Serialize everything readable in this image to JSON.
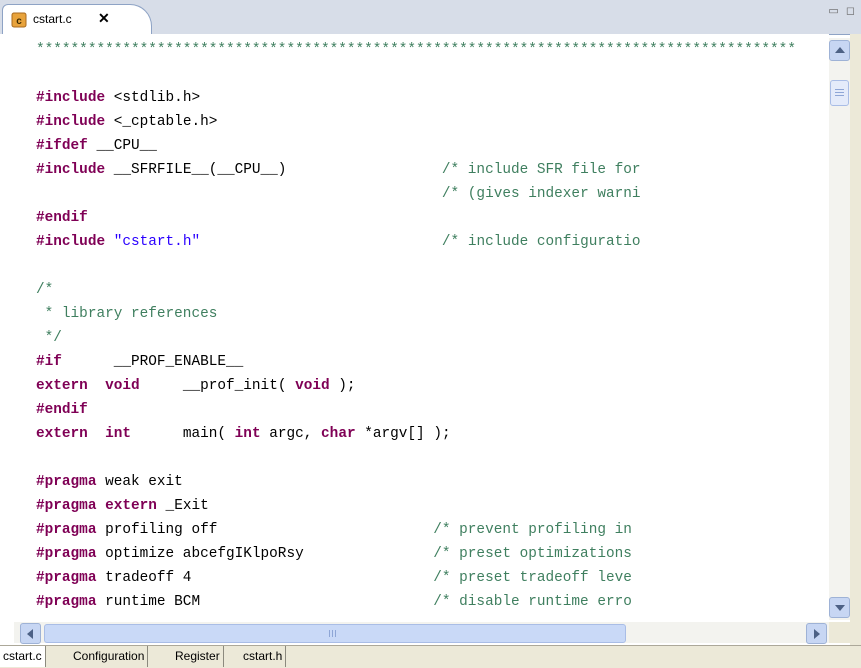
{
  "editor_tab": {
    "title": "cstart.c",
    "close_glyph": "✕",
    "icon": "c-source-file-icon"
  },
  "window_controls": {
    "minimize": "▭",
    "maximize": "◻"
  },
  "code_lines": [
    [
      {
        "t": "****************************************************************************************",
        "c": "cm"
      }
    ],
    [],
    [
      {
        "t": "#include",
        "c": "kw"
      },
      {
        "t": " <stdlib.h>"
      }
    ],
    [
      {
        "t": "#include",
        "c": "kw"
      },
      {
        "t": " <_cptable.h>"
      }
    ],
    [
      {
        "t": "#ifdef",
        "c": "kw"
      },
      {
        "t": " __CPU__"
      }
    ],
    [
      {
        "t": "#include",
        "c": "kw"
      },
      {
        "t": " __SFRFILE__(__CPU__)                  "
      },
      {
        "t": "/* include SFR file for",
        "c": "cm"
      }
    ],
    [
      {
        "t": "                                               "
      },
      {
        "t": "/* (gives indexer warni",
        "c": "cm"
      }
    ],
    [
      {
        "t": "#endif",
        "c": "kw"
      }
    ],
    [
      {
        "t": "#include",
        "c": "kw"
      },
      {
        "t": " "
      },
      {
        "t": "\"cstart.h\"",
        "c": "str"
      },
      {
        "t": "                            "
      },
      {
        "t": "/* include configuratio",
        "c": "cm"
      }
    ],
    [],
    [
      {
        "t": "/*",
        "c": "cm"
      }
    ],
    [
      {
        "t": " * library references",
        "c": "cm"
      }
    ],
    [
      {
        "t": " */",
        "c": "cm"
      }
    ],
    [
      {
        "t": "#if",
        "c": "kw"
      },
      {
        "t": "      __PROF_ENABLE__"
      }
    ],
    [
      {
        "t": "extern",
        "c": "kw"
      },
      {
        "t": "  "
      },
      {
        "t": "void",
        "c": "kw"
      },
      {
        "t": "     __prof_init( "
      },
      {
        "t": "void",
        "c": "kw"
      },
      {
        "t": " );"
      }
    ],
    [
      {
        "t": "#endif",
        "c": "kw"
      }
    ],
    [
      {
        "t": "extern",
        "c": "kw"
      },
      {
        "t": "  "
      },
      {
        "t": "int",
        "c": "kw"
      },
      {
        "t": "      main( "
      },
      {
        "t": "int",
        "c": "kw"
      },
      {
        "t": " argc, "
      },
      {
        "t": "char",
        "c": "kw"
      },
      {
        "t": " *argv[] );"
      }
    ],
    [],
    [
      {
        "t": "#pragma",
        "c": "kw"
      },
      {
        "t": " weak exit"
      }
    ],
    [
      {
        "t": "#pragma",
        "c": "kw"
      },
      {
        "t": " "
      },
      {
        "t": "extern",
        "c": "kw"
      },
      {
        "t": " _Exit"
      }
    ],
    [
      {
        "t": "#pragma",
        "c": "kw"
      },
      {
        "t": " profiling off                         "
      },
      {
        "t": "/* prevent profiling in",
        "c": "cm"
      }
    ],
    [
      {
        "t": "#pragma",
        "c": "kw"
      },
      {
        "t": " optimize abcefgIKlpoRsy               "
      },
      {
        "t": "/* preset optimizations",
        "c": "cm"
      }
    ],
    [
      {
        "t": "#pragma",
        "c": "kw"
      },
      {
        "t": " tradeoff 4                            "
      },
      {
        "t": "/* preset tradeoff leve",
        "c": "cm"
      }
    ],
    [
      {
        "t": "#pragma",
        "c": "kw"
      },
      {
        "t": " runtime BCM                           "
      },
      {
        "t": "/* disable runtime erro",
        "c": "cm"
      }
    ]
  ],
  "bottom_tabs": [
    {
      "label": "cstart.c",
      "active": true
    },
    {
      "label": "Configuration",
      "active": false
    },
    {
      "label": "Register",
      "active": false
    },
    {
      "label": "cstart.h",
      "active": false
    }
  ]
}
